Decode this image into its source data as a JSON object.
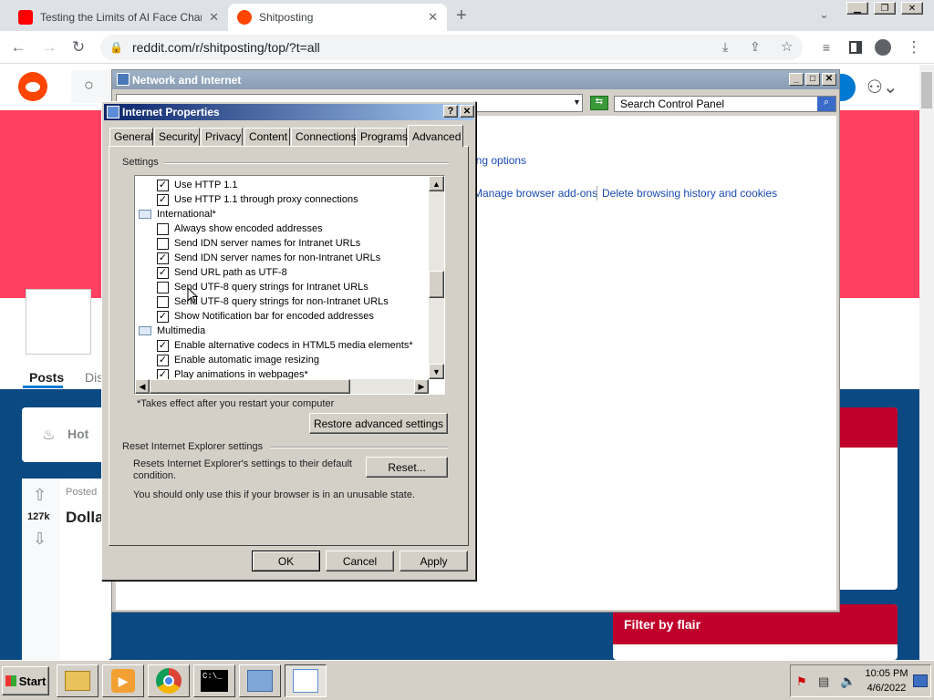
{
  "browser": {
    "tabs": [
      {
        "title": "Testing the Limits of AI Face Chang",
        "close": "✕"
      },
      {
        "title": "Shitposting",
        "close": "✕"
      }
    ],
    "new_tab": "+",
    "url": "reddit.com/r/shitposting/top/?t=all"
  },
  "reddit": {
    "nav_posts": "Posts",
    "nav_other": "Dis",
    "hot": "Hot",
    "vote_count": "127k",
    "posted": "Posted",
    "post_title": "Dolla",
    "filter_by_flair": "Filter by flair"
  },
  "control_panel": {
    "title": "Network and Internet",
    "search_placeholder": "Search Control Panel",
    "link_options": "ring options",
    "link_addons": "Manage browser add-ons",
    "link_history": "Delete browsing history and cookies"
  },
  "dialog": {
    "title": "Internet Properties",
    "help": "?",
    "close": "✕",
    "tabs": [
      "General",
      "Security",
      "Privacy",
      "Content",
      "Connections",
      "Programs",
      "Advanced"
    ],
    "settings_label": "Settings",
    "items": [
      {
        "type": "check",
        "checked": true,
        "label": "Use HTTP 1.1"
      },
      {
        "type": "check",
        "checked": true,
        "label": "Use HTTP 1.1 through proxy connections"
      },
      {
        "type": "group",
        "label": "International*"
      },
      {
        "type": "check",
        "checked": false,
        "label": "Always show encoded addresses"
      },
      {
        "type": "check",
        "checked": false,
        "label": "Send IDN server names for Intranet URLs"
      },
      {
        "type": "check",
        "checked": true,
        "label": "Send IDN server names for non-Intranet URLs"
      },
      {
        "type": "check",
        "checked": true,
        "label": "Send URL path as UTF-8"
      },
      {
        "type": "check",
        "checked": false,
        "label": "Send UTF-8 query strings for Intranet URLs"
      },
      {
        "type": "check",
        "checked": false,
        "label": "Send UTF-8 query strings for non-Intranet URLs"
      },
      {
        "type": "check",
        "checked": true,
        "label": "Show Notification bar for encoded addresses"
      },
      {
        "type": "group",
        "label": "Multimedia"
      },
      {
        "type": "check",
        "checked": true,
        "label": "Enable alternative codecs in HTML5 media elements*"
      },
      {
        "type": "check",
        "checked": true,
        "label": "Enable automatic image resizing"
      },
      {
        "type": "check",
        "checked": true,
        "label": "Play animations in webpages*"
      }
    ],
    "restart_note": "*Takes effect after you restart your computer",
    "restore_button": "Restore advanced settings",
    "reset_group": "Reset Internet Explorer settings",
    "reset_text": "Resets Internet Explorer's settings to their default condition.",
    "reset_button": "Reset...",
    "unusable_text": "You should only use this if your browser is in an unusable state.",
    "ok": "OK",
    "cancel": "Cancel",
    "apply": "Apply"
  },
  "taskbar": {
    "start": "Start",
    "time": "10:05 PM",
    "date": "4/6/2022"
  }
}
